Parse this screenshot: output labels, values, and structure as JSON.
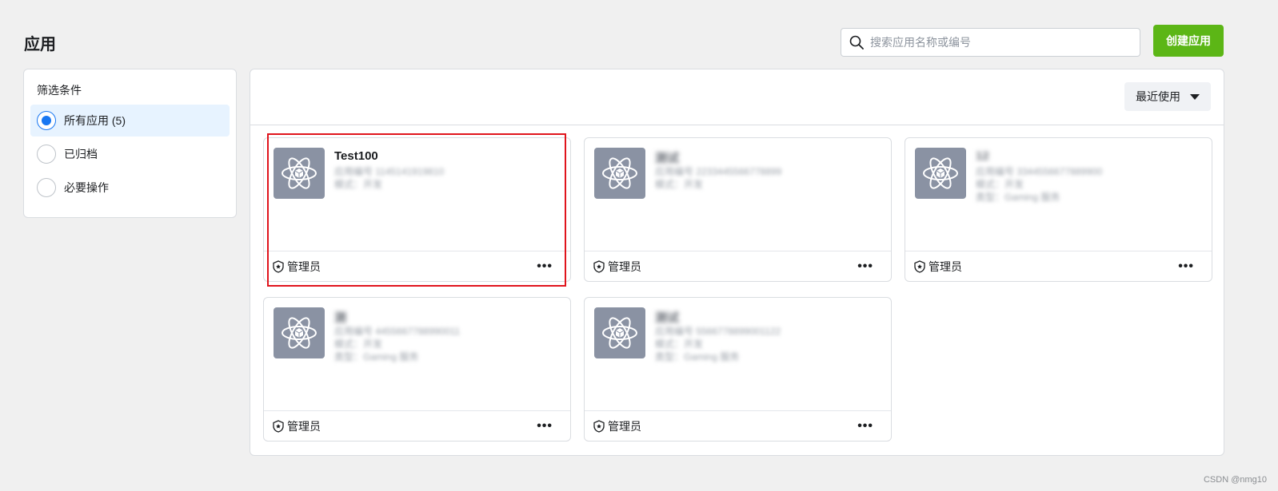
{
  "header": {
    "title": "应用",
    "search_placeholder": "搜索应用名称或编号",
    "create_label": "创建应用"
  },
  "filter": {
    "title": "筛选条件",
    "options": [
      {
        "label": "所有应用 (5)",
        "selected": true
      },
      {
        "label": "已归档",
        "selected": false
      },
      {
        "label": "必要操作",
        "selected": false
      }
    ]
  },
  "sort": {
    "label": "最近使用"
  },
  "apps": [
    {
      "name": "Test100",
      "meta": [
        "应用编号 1145141919810",
        "模式：开发"
      ],
      "role": "管理员"
    },
    {
      "name": "测试",
      "meta": [
        "应用编号 2233445566778899",
        "模式：开发"
      ],
      "role": "管理员"
    },
    {
      "name": "12",
      "meta": [
        "应用编号 3344556677889900",
        "模式：开发",
        "类型：Gaming 服务"
      ],
      "role": "管理员"
    },
    {
      "name": "测",
      "meta": [
        "应用编号 4455667788990011",
        "模式：开发",
        "类型：Gaming 服务"
      ],
      "role": "管理员"
    },
    {
      "name": "测试",
      "meta": [
        "应用编号 5566778899001122",
        "模式：开发",
        "类型：Gaming 服务"
      ],
      "role": "管理员"
    }
  ],
  "footer": {
    "watermark": "CSDN @nmg10"
  },
  "colors": {
    "accent": "#5cb616",
    "selected_bg": "#e7f3ff",
    "radio_on": "#1877f2",
    "highlight": "#e0141c",
    "icon_tile": "#8a92a3"
  },
  "icons": {
    "search": "search-icon",
    "app": "atom-icon",
    "role": "shield-star-icon",
    "more": "more-horizontal-icon",
    "sort": "caret-down-icon"
  }
}
